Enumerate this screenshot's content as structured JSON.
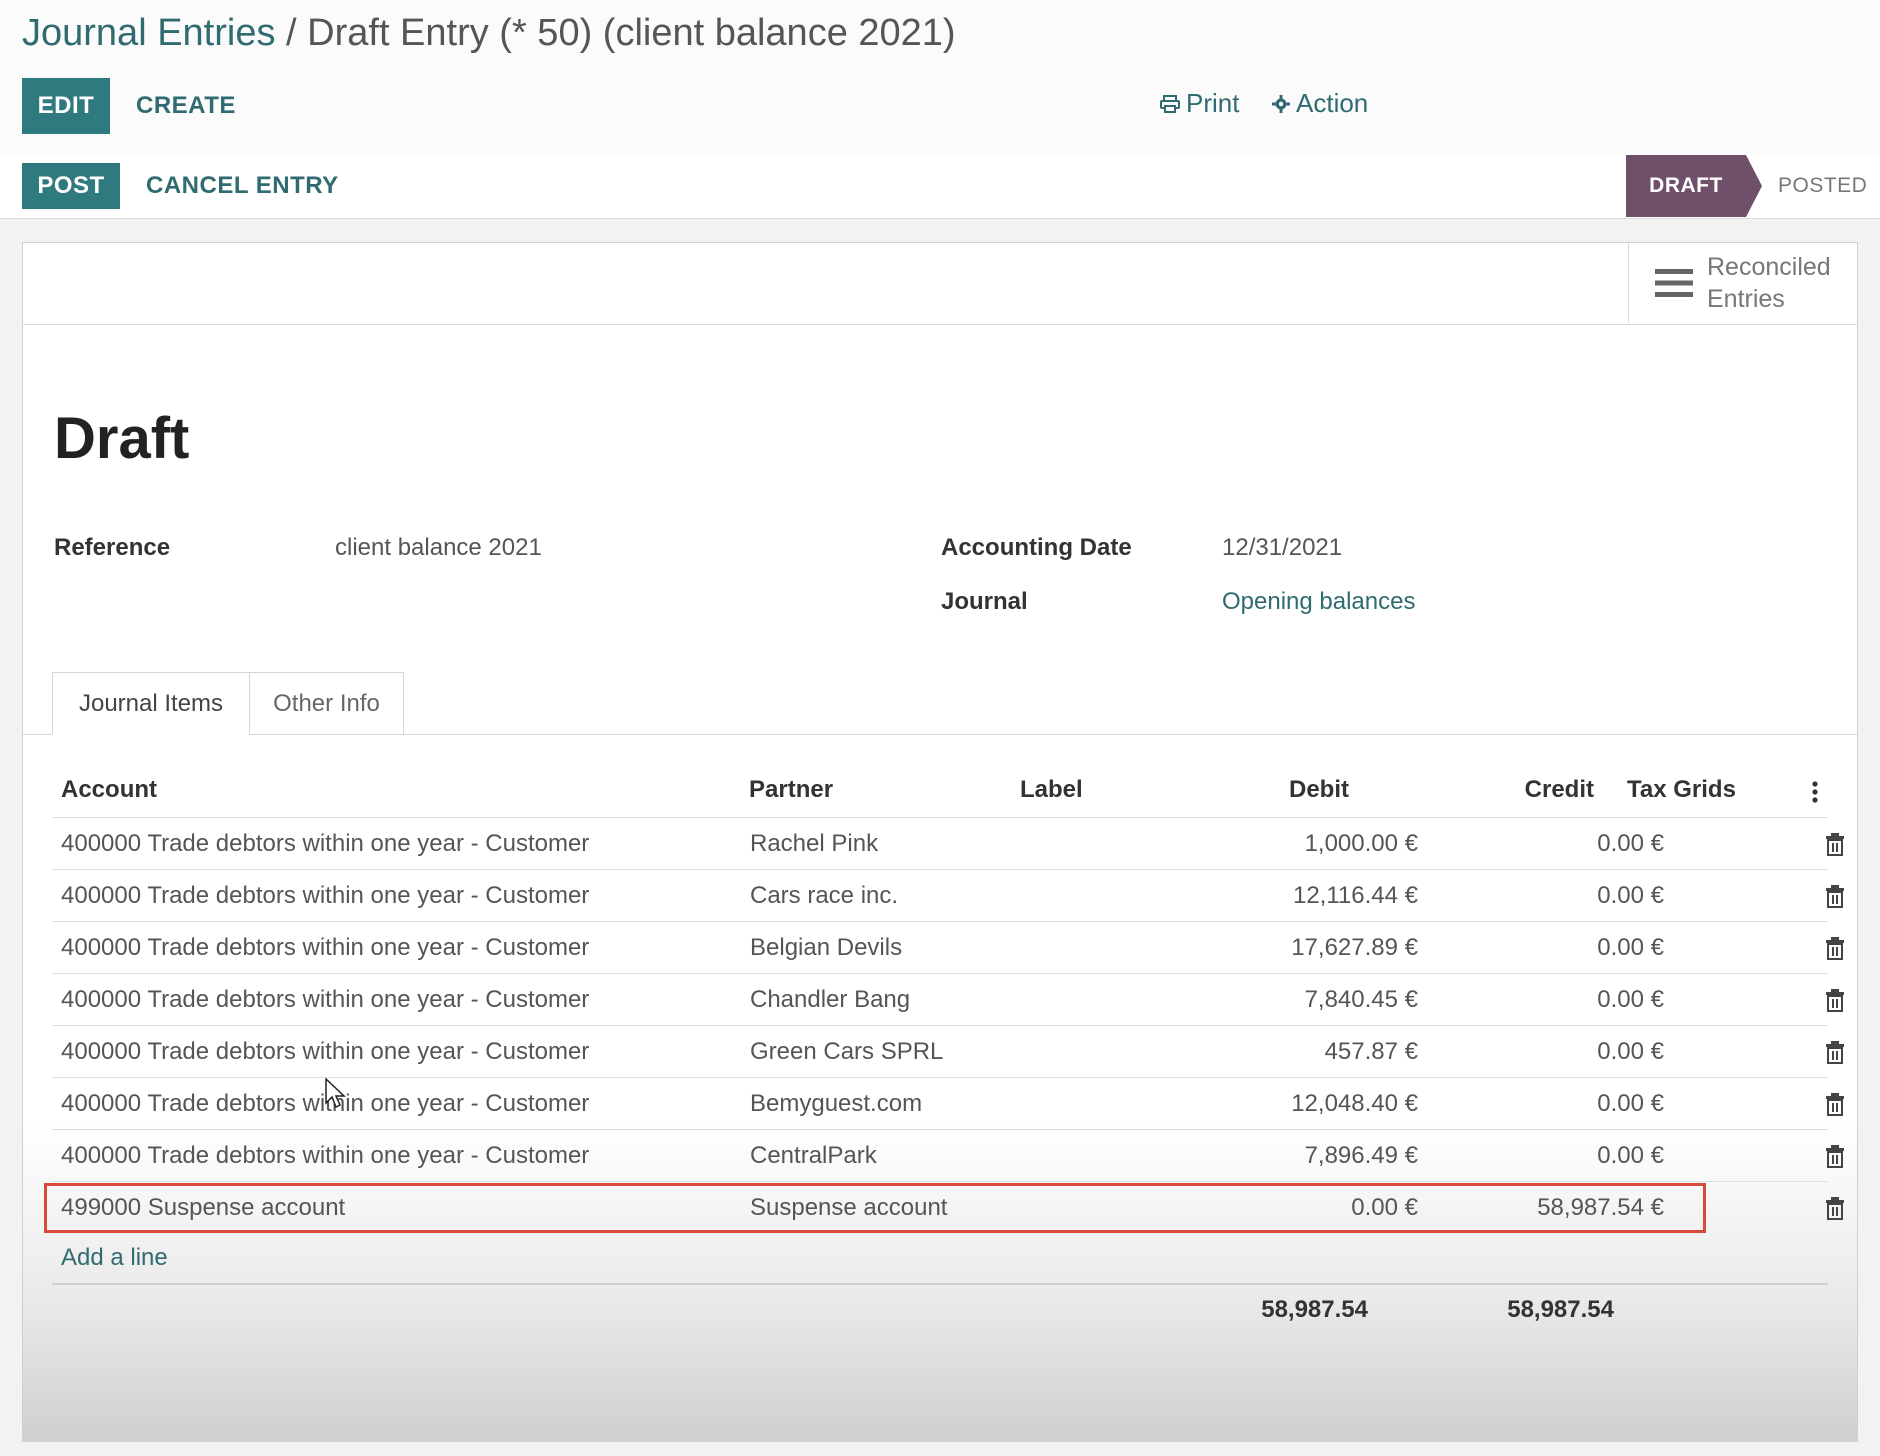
{
  "breadcrumb": {
    "parent": "Journal Entries",
    "separator": " / ",
    "current": "Draft Entry (* 50) (client balance 2021)"
  },
  "toolbar": {
    "edit_label": "EDIT",
    "create_label": "CREATE",
    "print_label": "Print",
    "action_label": "Action"
  },
  "statusbar": {
    "post_label": "POST",
    "cancel_label": "CANCEL ENTRY",
    "stages": [
      "DRAFT",
      "POSTED"
    ],
    "current_stage": "DRAFT"
  },
  "smart_button": {
    "line1": "Reconciled",
    "line2": "Entries"
  },
  "form": {
    "title": "Draft",
    "reference_label": "Reference",
    "reference_value": "client balance 2021",
    "date_label": "Accounting Date",
    "date_value": "12/31/2021",
    "journal_label": "Journal",
    "journal_value": "Opening balances"
  },
  "tabs": [
    "Journal Items",
    "Other Info"
  ],
  "table": {
    "headers": {
      "account": "Account",
      "partner": "Partner",
      "label": "Label",
      "debit": "Debit",
      "credit": "Credit",
      "tax_grids": "Tax Grids"
    },
    "rows": [
      {
        "account": "400000 Trade debtors within one year - Customer",
        "partner": "Rachel Pink",
        "label": "",
        "debit": "1,000.00 €",
        "credit": "0.00 €"
      },
      {
        "account": "400000 Trade debtors within one year - Customer",
        "partner": "Cars race inc.",
        "label": "",
        "debit": "12,116.44 €",
        "credit": "0.00 €"
      },
      {
        "account": "400000 Trade debtors within one year - Customer",
        "partner": "Belgian Devils",
        "label": "",
        "debit": "17,627.89 €",
        "credit": "0.00 €"
      },
      {
        "account": "400000 Trade debtors within one year - Customer",
        "partner": "Chandler Bang",
        "label": "",
        "debit": "7,840.45 €",
        "credit": "0.00 €"
      },
      {
        "account": "400000 Trade debtors within one year - Customer",
        "partner": "Green Cars SPRL",
        "label": "",
        "debit": "457.87 €",
        "credit": "0.00 €"
      },
      {
        "account": "400000 Trade debtors within one year - Customer",
        "partner": "Bemyguest.com",
        "label": "",
        "debit": "12,048.40 €",
        "credit": "0.00 €"
      },
      {
        "account": "400000 Trade debtors within one year - Customer",
        "partner": "CentralPark",
        "label": "",
        "debit": "7,896.49 €",
        "credit": "0.00 €"
      },
      {
        "account": "499000 Suspense account",
        "partner": "Suspense account",
        "label": "",
        "debit": "0.00 €",
        "credit": "58,987.54 €"
      }
    ],
    "add_line_label": "Add a line",
    "total_debit": "58,987.54",
    "total_credit": "58,987.54"
  },
  "colors": {
    "primary": "#2f7a7e",
    "stage_active": "#6f4f6a",
    "highlight_border": "#d9493a",
    "link": "#2f6b70"
  }
}
